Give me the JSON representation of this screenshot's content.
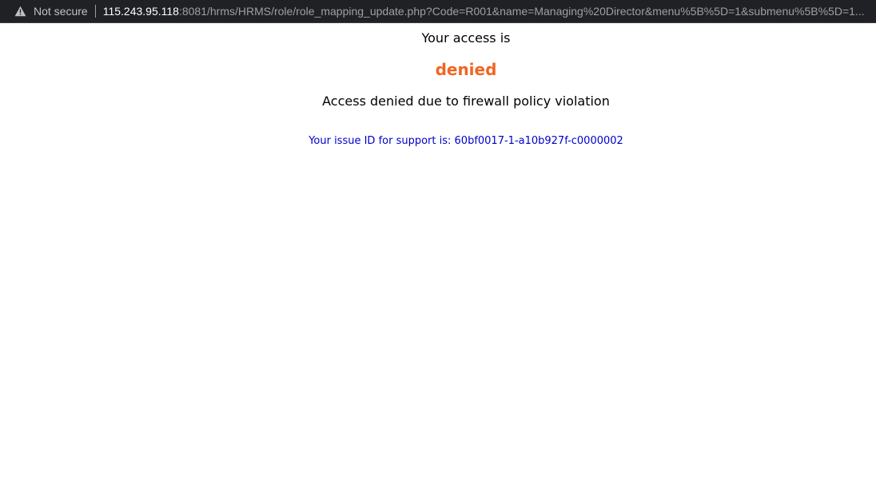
{
  "browser": {
    "security_label": "Not secure",
    "url_host": "115.243.95.118",
    "url_rest": ":8081/hrms/HRMS/role/role_mapping_update.php?Code=R001&name=Managing%20Director&menu%5B%5D=1&submenu%5B%5D=1...",
    "icon": "warning-triangle-icon"
  },
  "page": {
    "line1": "Your access is",
    "status_word": "denied",
    "reason": "Access denied due to firewall policy violation",
    "issue_text": "Your issue ID for support is: 60bf0017-1-a10b927f-c0000002"
  },
  "colors": {
    "status_word": "#f26522",
    "issue_text": "#0000cc"
  }
}
